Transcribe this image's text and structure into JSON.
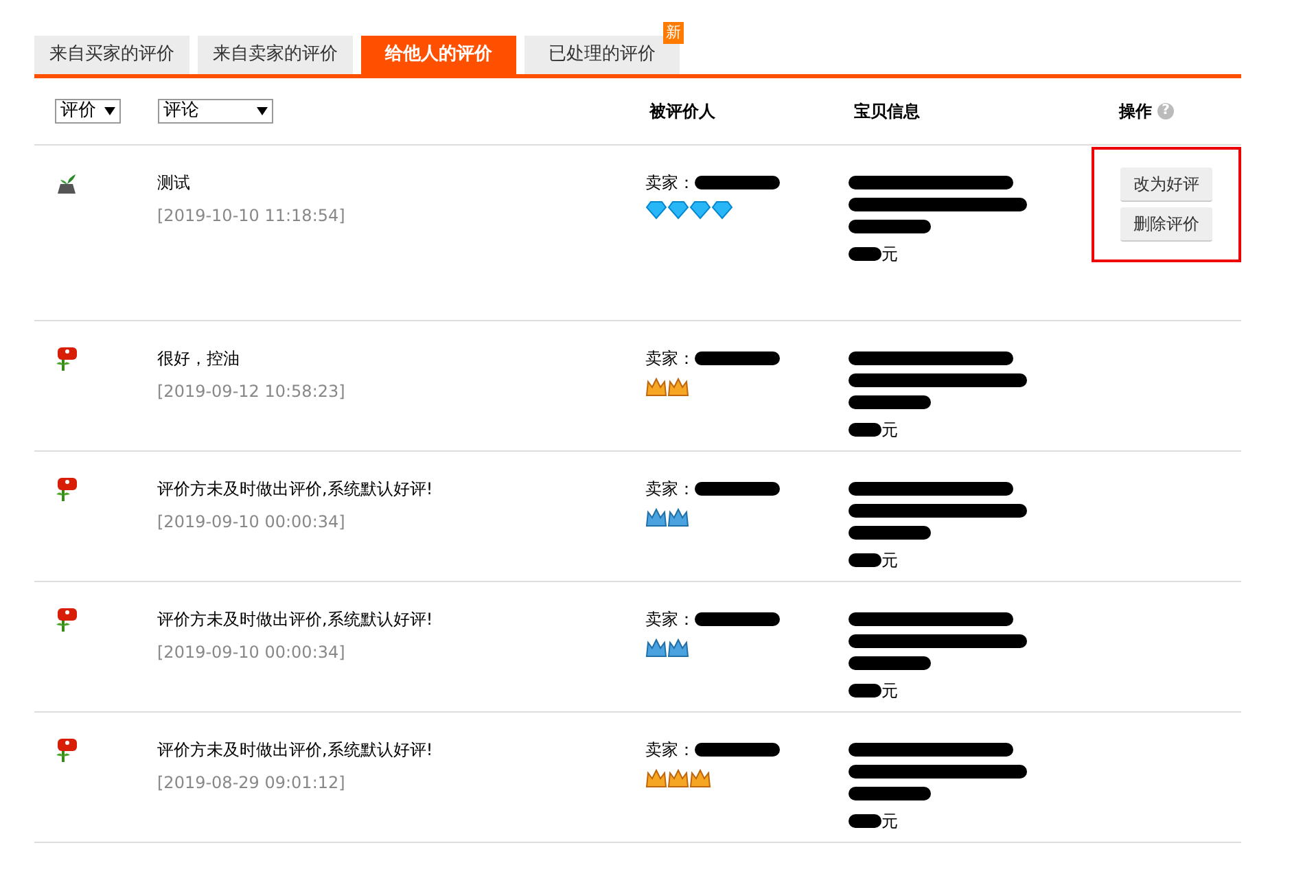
{
  "tabs": [
    {
      "label": "来自买家的评价",
      "selected": false
    },
    {
      "label": "来自卖家的评价",
      "selected": false
    },
    {
      "label": "给他人的评价",
      "selected": true
    },
    {
      "label": "已处理的评价",
      "selected": false,
      "new_badge": "新"
    }
  ],
  "header": {
    "rating_select": "评价",
    "comment_select": "评论",
    "rated_person": "被评价人",
    "item_info": "宝贝信息",
    "actions": "操作",
    "help_icon": "?"
  },
  "rows": [
    {
      "rating": {
        "kind": "neutral"
      },
      "comment": "测试",
      "time": "[2019-10-10 11:18:54]",
      "seller_label": "卖家：",
      "badges": [
        {
          "kind": "diamond"
        },
        {
          "kind": "diamond"
        },
        {
          "kind": "diamond"
        },
        {
          "kind": "diamond"
        }
      ],
      "price_unit": "元",
      "buttons": [
        "改为好评",
        "删除评价"
      ],
      "highlighted": true
    },
    {
      "rating": {
        "kind": "good"
      },
      "comment": "很好，控油",
      "time": "[2019-09-12 10:58:23]",
      "seller_label": "卖家：",
      "badges": [
        {
          "kind": "gold-crown"
        },
        {
          "kind": "gold-crown"
        }
      ],
      "price_unit": "元",
      "highlighted": false
    },
    {
      "rating": {
        "kind": "good"
      },
      "comment": "评价方未及时做出评价,系统默认好评!",
      "time": "[2019-09-10 00:00:34]",
      "seller_label": "卖家：",
      "badges": [
        {
          "kind": "blue-crown"
        },
        {
          "kind": "blue-crown"
        }
      ],
      "price_unit": "元",
      "highlighted": false
    },
    {
      "rating": {
        "kind": "good"
      },
      "comment": "评价方未及时做出评价,系统默认好评!",
      "time": "[2019-09-10 00:00:34]",
      "seller_label": "卖家：",
      "badges": [
        {
          "kind": "blue-crown"
        },
        {
          "kind": "blue-crown"
        }
      ],
      "price_unit": "元",
      "highlighted": false
    },
    {
      "rating": {
        "kind": "good"
      },
      "comment": "评价方未及时做出评价,系统默认好评!",
      "time": "[2019-08-29 09:01:12]",
      "seller_label": "卖家：",
      "badges": [
        {
          "kind": "gold-crown"
        },
        {
          "kind": "gold-crown"
        },
        {
          "kind": "gold-crown"
        }
      ],
      "price_unit": "元",
      "highlighted": false
    }
  ]
}
